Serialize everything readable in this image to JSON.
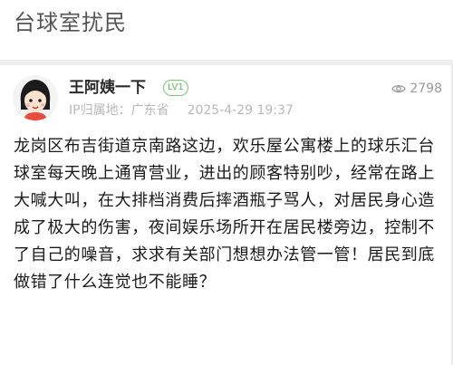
{
  "page": {
    "title": "台球室扰民"
  },
  "post": {
    "author": "王阿姨一下",
    "level": "LV1",
    "views": "2798",
    "ip_location": "IP归属地：广东省",
    "date": "2025-4-29 19:37",
    "content": "龙岗区布吉街道京南路这边，欢乐屋公寓楼上的球乐汇台球室每天晚上通宵营业，进出的顾客特别吵，经常在路上大喊大叫，在大排档消费后摔酒瓶子骂人，对居民身心造成了极大的伤害，夜间娱乐场所开在居民楼旁边，控制不了自己的噪音，求求有关部门想想办法管一管！居民到底做错了什么连觉也不能睡？"
  },
  "icons": {
    "views": "eye-icon",
    "avatar": "cartoon-girl-avatar"
  },
  "colors": {
    "level_badge": "#5cb85c",
    "meta_text": "#b8b8b8",
    "divider": "#eeeeee"
  }
}
